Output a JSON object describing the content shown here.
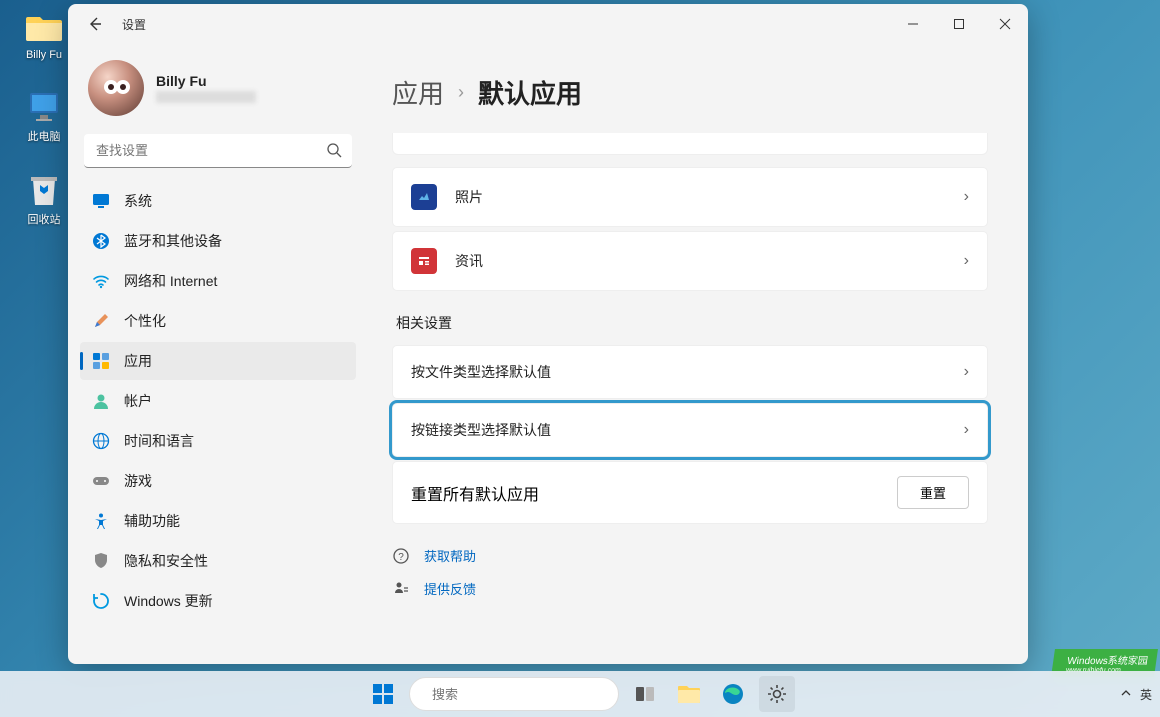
{
  "desktop": {
    "icons": [
      {
        "label": "Billy Fu",
        "type": "folder"
      },
      {
        "label": "此电脑",
        "type": "pc"
      },
      {
        "label": "回收站",
        "type": "trash"
      }
    ]
  },
  "titlebar": {
    "title": "设置"
  },
  "profile": {
    "name": "Billy Fu"
  },
  "search": {
    "placeholder": "查找设置"
  },
  "nav": [
    {
      "icon": "system",
      "label": "系统"
    },
    {
      "icon": "bluetooth",
      "label": "蓝牙和其他设备"
    },
    {
      "icon": "wifi",
      "label": "网络和 Internet"
    },
    {
      "icon": "personalize",
      "label": "个性化"
    },
    {
      "icon": "apps",
      "label": "应用",
      "active": true
    },
    {
      "icon": "account",
      "label": "帐户"
    },
    {
      "icon": "time",
      "label": "时间和语言"
    },
    {
      "icon": "gaming",
      "label": "游戏"
    },
    {
      "icon": "access",
      "label": "辅助功能"
    },
    {
      "icon": "privacy",
      "label": "隐私和安全性"
    },
    {
      "icon": "update",
      "label": "Windows 更新"
    }
  ],
  "breadcrumb": {
    "root": "应用",
    "current": "默认应用"
  },
  "app_cards": [
    {
      "label": "照片",
      "iconColor": "#1c3f94"
    },
    {
      "label": "资讯",
      "iconColor": "#d13438"
    }
  ],
  "related": {
    "heading": "相关设置",
    "items": [
      {
        "label": "按文件类型选择默认值",
        "highlight": false
      },
      {
        "label": "按链接类型选择默认值",
        "highlight": true
      }
    ],
    "reset": {
      "label": "重置所有默认应用",
      "button": "重置"
    }
  },
  "help_links": [
    {
      "icon": "help",
      "label": "获取帮助"
    },
    {
      "icon": "feedback",
      "label": "提供反馈"
    }
  ],
  "taskbar": {
    "search_placeholder": "搜索",
    "tray_lang": "英"
  },
  "watermark": {
    "main": "Windows系统家园",
    "sub": "www.ruihiefu.com"
  }
}
